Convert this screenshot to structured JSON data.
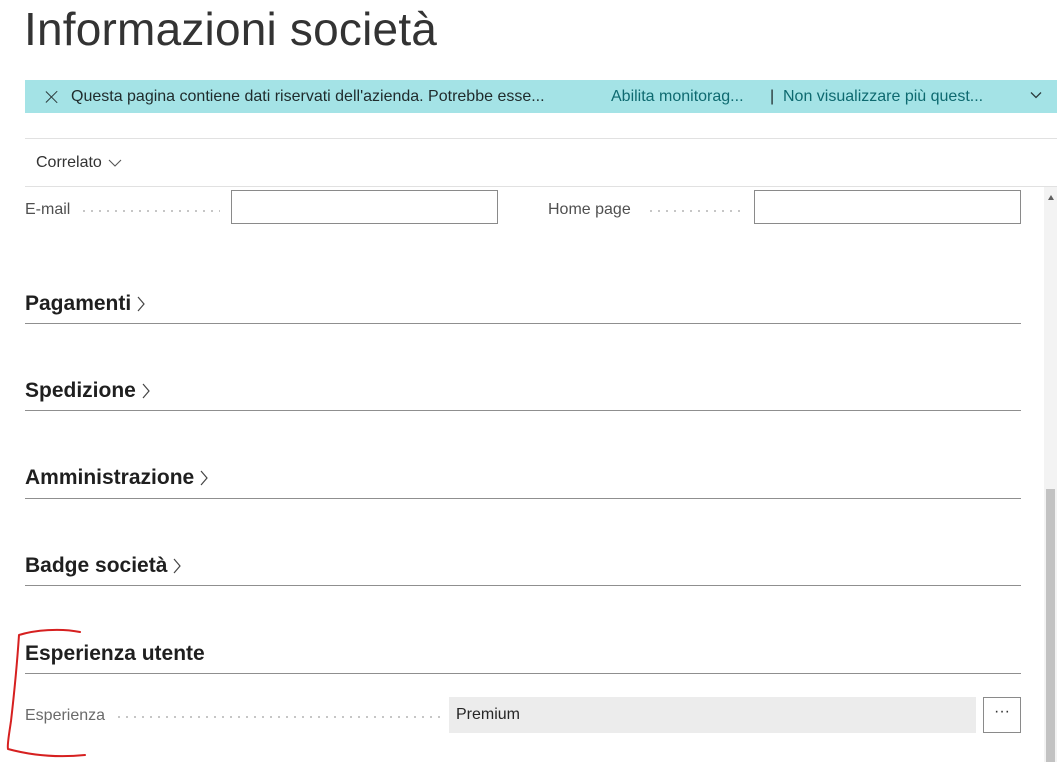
{
  "page": {
    "title": "Informazioni società"
  },
  "banner": {
    "message": "Questa pagina contiene dati riservati dell'azienda. Potrebbe esse...",
    "enable_link": "Abilita monitorag...",
    "separator": "|",
    "dismiss_link": "Non visualizzare più quest...",
    "color": "#a4e3e6"
  },
  "actionbar": {
    "related_label": "Correlato"
  },
  "contact": {
    "email_label": "E-mail",
    "email_value": "",
    "homepage_label": "Home page",
    "homepage_value": ""
  },
  "sections": [
    {
      "label": "Pagamenti"
    },
    {
      "label": "Spedizione"
    },
    {
      "label": "Amministrazione"
    },
    {
      "label": "Badge società"
    }
  ],
  "user_experience": {
    "header": "Esperienza utente",
    "experience_label": "Esperienza",
    "experience_value": "Premium",
    "lookup_button": "···"
  },
  "annotation_color": "#d62020"
}
